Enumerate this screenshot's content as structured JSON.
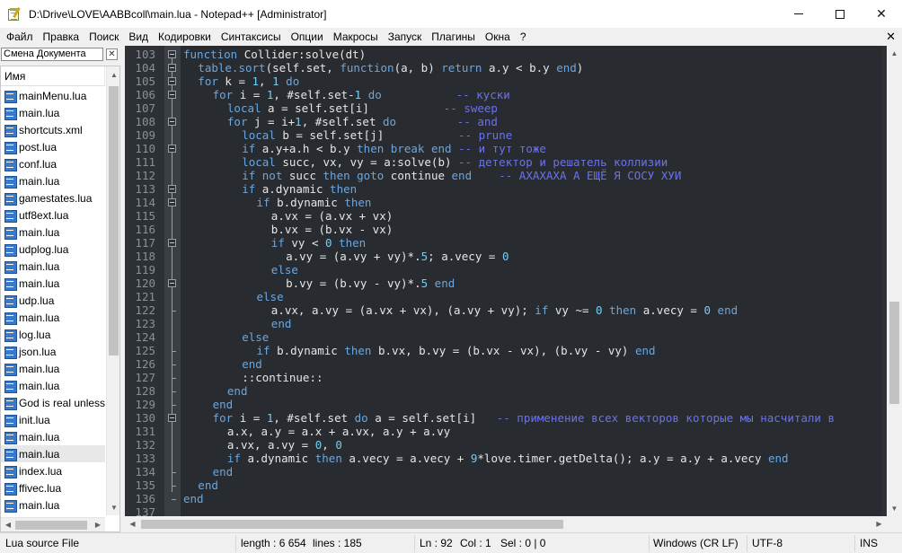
{
  "window": {
    "title": "D:\\Drive\\LOVE\\AABBcoll\\main.lua - Notepad++ [Administrator]",
    "minimize_glyph": "",
    "maximize_glyph": "",
    "close_glyph": "✕"
  },
  "menu": {
    "items": [
      "Файл",
      "Правка",
      "Поиск",
      "Вид",
      "Кодировки",
      "Синтаксисы",
      "Опции",
      "Макросы",
      "Запуск",
      "Плагины",
      "Окна",
      "?"
    ],
    "close_glyph": "✕"
  },
  "doc_panel": {
    "title": "Смена Документа",
    "close_glyph": "✕",
    "column_header": "Имя",
    "files": [
      {
        "name": "mainMenu.lua",
        "selected": false
      },
      {
        "name": "main.lua",
        "selected": false
      },
      {
        "name": "shortcuts.xml",
        "selected": false
      },
      {
        "name": "post.lua",
        "selected": false
      },
      {
        "name": "conf.lua",
        "selected": false
      },
      {
        "name": "main.lua",
        "selected": false
      },
      {
        "name": "gamestates.lua",
        "selected": false
      },
      {
        "name": "utf8ext.lua",
        "selected": false
      },
      {
        "name": "main.lua",
        "selected": false
      },
      {
        "name": "udplog.lua",
        "selected": false
      },
      {
        "name": "main.lua",
        "selected": false
      },
      {
        "name": "main.lua",
        "selected": false
      },
      {
        "name": "udp.lua",
        "selected": false
      },
      {
        "name": "main.lua",
        "selected": false
      },
      {
        "name": "log.lua",
        "selected": false
      },
      {
        "name": "json.lua",
        "selected": false
      },
      {
        "name": "main.lua",
        "selected": false
      },
      {
        "name": "main.lua",
        "selected": false
      },
      {
        "name": "God is real unless",
        "selected": false
      },
      {
        "name": "init.lua",
        "selected": false
      },
      {
        "name": "main.lua",
        "selected": false
      },
      {
        "name": "main.lua",
        "selected": true
      },
      {
        "name": "index.lua",
        "selected": false
      },
      {
        "name": "ffivec.lua",
        "selected": false
      },
      {
        "name": "main.lua",
        "selected": false
      }
    ],
    "icon": "lua-file-icon"
  },
  "editor": {
    "colors": {
      "background": "#282c30",
      "keyword": "#6ba6e0",
      "number": "#6fd0f5",
      "comment": "#6b72e8",
      "text": "#e6e6e6",
      "line_number": "#8a9095"
    },
    "lines": [
      {
        "n": "103",
        "indent": 0,
        "tokens": [
          [
            "kw",
            "function"
          ],
          [
            "t",
            " Collider:solve(dt)"
          ]
        ]
      },
      {
        "n": "104",
        "indent": 1,
        "tokens": [
          [
            "kw",
            "table.sort"
          ],
          [
            "t",
            "(self.set, "
          ],
          [
            "kw",
            "function"
          ],
          [
            "t",
            "(a, b) "
          ],
          [
            "kw",
            "return"
          ],
          [
            "t",
            " a.y < b.y "
          ],
          [
            "kw",
            "end"
          ],
          [
            "t",
            ")"
          ]
        ]
      },
      {
        "n": "105",
        "indent": 1,
        "tokens": [
          [
            "kw",
            "for"
          ],
          [
            "t",
            " k = "
          ],
          [
            "num",
            "1"
          ],
          [
            "t",
            ", "
          ],
          [
            "num",
            "1"
          ],
          [
            "t",
            " "
          ],
          [
            "kw",
            "do"
          ]
        ]
      },
      {
        "n": "106",
        "indent": 2,
        "tokens": [
          [
            "kw",
            "for"
          ],
          [
            "t",
            " i = "
          ],
          [
            "num",
            "1"
          ],
          [
            "t",
            ", #self.set-"
          ],
          [
            "num",
            "1"
          ],
          [
            "t",
            " "
          ],
          [
            "kw",
            "do"
          ],
          [
            "t",
            "           "
          ],
          [
            "cmt",
            "-- куски"
          ]
        ]
      },
      {
        "n": "107",
        "indent": 3,
        "tokens": [
          [
            "kw",
            "local"
          ],
          [
            "t",
            " a = self.set[i]"
          ],
          [
            "t",
            "           "
          ],
          [
            "cmt",
            "-- sweep"
          ]
        ]
      },
      {
        "n": "108",
        "indent": 3,
        "tokens": [
          [
            "kw",
            "for"
          ],
          [
            "t",
            " j = i+"
          ],
          [
            "num",
            "1"
          ],
          [
            "t",
            ", #self.set "
          ],
          [
            "kw",
            "do"
          ],
          [
            "t",
            "         "
          ],
          [
            "cmt",
            "-- and"
          ]
        ]
      },
      {
        "n": "109",
        "indent": 4,
        "tokens": [
          [
            "kw",
            "local"
          ],
          [
            "t",
            " b = self.set[j]"
          ],
          [
            "t",
            "           "
          ],
          [
            "cmt",
            "-- prune"
          ]
        ]
      },
      {
        "n": "110",
        "indent": 4,
        "tokens": [
          [
            "kw",
            "if"
          ],
          [
            "t",
            " a.y+a.h < b.y "
          ],
          [
            "kw",
            "then"
          ],
          [
            "t",
            " "
          ],
          [
            "kw",
            "break"
          ],
          [
            "t",
            " "
          ],
          [
            "kw",
            "end"
          ],
          [
            "t",
            " "
          ],
          [
            "cmt",
            "-- и тут тоже"
          ]
        ]
      },
      {
        "n": "111",
        "indent": 4,
        "tokens": [
          [
            "kw",
            "local"
          ],
          [
            "t",
            " succ, vx, vy = a:solve(b) "
          ],
          [
            "cmt",
            "-- детектор и решатель коллизии"
          ]
        ]
      },
      {
        "n": "112",
        "indent": 4,
        "tokens": [
          [
            "kw",
            "if"
          ],
          [
            "t",
            " "
          ],
          [
            "kw",
            "not"
          ],
          [
            "t",
            " succ "
          ],
          [
            "kw",
            "then"
          ],
          [
            "t",
            " "
          ],
          [
            "kw",
            "goto"
          ],
          [
            "t",
            " continue "
          ],
          [
            "kw",
            "end"
          ],
          [
            "t",
            "    "
          ],
          [
            "cmt",
            "-- АХАХАХА А ЕЩЁ Я СОСУ ХУИ"
          ]
        ]
      },
      {
        "n": "113",
        "indent": 4,
        "tokens": [
          [
            "kw",
            "if"
          ],
          [
            "t",
            " a.dynamic "
          ],
          [
            "kw",
            "then"
          ]
        ]
      },
      {
        "n": "114",
        "indent": 5,
        "tokens": [
          [
            "kw",
            "if"
          ],
          [
            "t",
            " b.dynamic "
          ],
          [
            "kw",
            "then"
          ]
        ]
      },
      {
        "n": "115",
        "indent": 6,
        "tokens": [
          [
            "t",
            "a.vx = (a.vx + vx)"
          ]
        ]
      },
      {
        "n": "116",
        "indent": 6,
        "tokens": [
          [
            "t",
            "b.vx = (b.vx - vx)"
          ]
        ]
      },
      {
        "n": "117",
        "indent": 6,
        "tokens": [
          [
            "kw",
            "if"
          ],
          [
            "t",
            " vy < "
          ],
          [
            "num",
            "0"
          ],
          [
            "t",
            " "
          ],
          [
            "kw",
            "then"
          ]
        ]
      },
      {
        "n": "118",
        "indent": 7,
        "tokens": [
          [
            "t",
            "a.vy = (a.vy + vy)*."
          ],
          [
            "num",
            "5"
          ],
          [
            "t",
            "; a.vecy = "
          ],
          [
            "num",
            "0"
          ]
        ]
      },
      {
        "n": "119",
        "indent": 6,
        "tokens": [
          [
            "kw",
            "else"
          ]
        ]
      },
      {
        "n": "120",
        "indent": 7,
        "tokens": [
          [
            "t",
            "b.vy = (b.vy - vy)*."
          ],
          [
            "num",
            "5"
          ],
          [
            "t",
            " "
          ],
          [
            "kw",
            "end"
          ]
        ]
      },
      {
        "n": "121",
        "indent": 5,
        "tokens": [
          [
            "kw",
            "else"
          ]
        ]
      },
      {
        "n": "122",
        "indent": 6,
        "tokens": [
          [
            "t",
            "a.vx, a.vy = (a.vx + vx), (a.vy + vy); "
          ],
          [
            "kw",
            "if"
          ],
          [
            "t",
            " vy ~= "
          ],
          [
            "num",
            "0"
          ],
          [
            "t",
            " "
          ],
          [
            "kw",
            "then"
          ],
          [
            "t",
            " a.vecy = "
          ],
          [
            "num",
            "0"
          ],
          [
            "t",
            " "
          ],
          [
            "kw",
            "end"
          ]
        ]
      },
      {
        "n": "123",
        "indent": 6,
        "tokens": [
          [
            "kw",
            "end"
          ]
        ]
      },
      {
        "n": "124",
        "indent": 4,
        "tokens": [
          [
            "kw",
            "else"
          ]
        ]
      },
      {
        "n": "125",
        "indent": 5,
        "tokens": [
          [
            "kw",
            "if"
          ],
          [
            "t",
            " b.dynamic "
          ],
          [
            "kw",
            "then"
          ],
          [
            "t",
            " b.vx, b.vy = (b.vx - vx), (b.vy - vy) "
          ],
          [
            "kw",
            "end"
          ]
        ]
      },
      {
        "n": "126",
        "indent": 4,
        "tokens": [
          [
            "kw",
            "end"
          ]
        ]
      },
      {
        "n": "127",
        "indent": 4,
        "tokens": [
          [
            "t",
            "::continue::"
          ]
        ]
      },
      {
        "n": "128",
        "indent": 3,
        "tokens": [
          [
            "kw",
            "end"
          ]
        ]
      },
      {
        "n": "129",
        "indent": 2,
        "tokens": [
          [
            "kw",
            "end"
          ]
        ]
      },
      {
        "n": "130",
        "indent": 2,
        "tokens": [
          [
            "kw",
            "for"
          ],
          [
            "t",
            " i = "
          ],
          [
            "num",
            "1"
          ],
          [
            "t",
            ", #self.set "
          ],
          [
            "kw",
            "do"
          ],
          [
            "t",
            " a = self.set[i]   "
          ],
          [
            "cmt",
            "-- применение всех векторов которые мы насчитали в"
          ]
        ]
      },
      {
        "n": "131",
        "indent": 3,
        "tokens": [
          [
            "t",
            "a.x, a.y = a.x + a.vx, a.y + a.vy"
          ]
        ]
      },
      {
        "n": "132",
        "indent": 3,
        "tokens": [
          [
            "t",
            "a.vx, a.vy = "
          ],
          [
            "num",
            "0"
          ],
          [
            "t",
            ", "
          ],
          [
            "num",
            "0"
          ]
        ]
      },
      {
        "n": "133",
        "indent": 3,
        "tokens": [
          [
            "kw",
            "if"
          ],
          [
            "t",
            " a.dynamic "
          ],
          [
            "kw",
            "then"
          ],
          [
            "t",
            " a.vecy = a.vecy + "
          ],
          [
            "num",
            "9"
          ],
          [
            "t",
            "*love.timer.getDelta(); a.y = a.y + a.vecy "
          ],
          [
            "kw",
            "end"
          ]
        ]
      },
      {
        "n": "134",
        "indent": 2,
        "tokens": [
          [
            "kw",
            "end"
          ]
        ]
      },
      {
        "n": "135",
        "indent": 1,
        "tokens": [
          [
            "kw",
            "end"
          ]
        ]
      },
      {
        "n": "136",
        "indent": 0,
        "tokens": [
          [
            "kw",
            "end"
          ]
        ]
      },
      {
        "n": "137",
        "indent": 0,
        "tokens": []
      }
    ]
  },
  "status": {
    "file_type": "Lua source File",
    "length": "length : 6 654",
    "lines": "lines : 185",
    "ln": "Ln : 92",
    "col": "Col : 1",
    "sel": "Sel : 0 | 0",
    "eol": "Windows (CR LF)",
    "encoding": "UTF-8",
    "mode": "INS"
  }
}
